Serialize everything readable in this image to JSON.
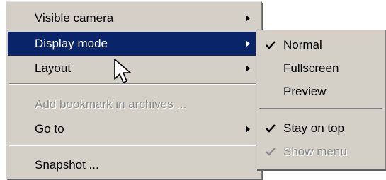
{
  "main_menu": {
    "items": [
      {
        "label": "Visible camera"
      },
      {
        "label": "Display mode"
      },
      {
        "label": "Layout"
      },
      {
        "label": "Add bookmark in archives ..."
      },
      {
        "label": "Go to"
      },
      {
        "label": "Snapshot ..."
      }
    ]
  },
  "submenu": {
    "items": [
      {
        "label": "Normal",
        "checked": true
      },
      {
        "label": "Fullscreen",
        "checked": false
      },
      {
        "label": "Preview",
        "checked": false
      },
      {
        "label": "Stay on top",
        "checked": true
      },
      {
        "label": "Show menu",
        "checked": true
      }
    ]
  },
  "colors": {
    "menu_bg": "#d4d0c8",
    "highlight_bg": "#0a246a",
    "disabled_text": "#8c8c8c"
  }
}
